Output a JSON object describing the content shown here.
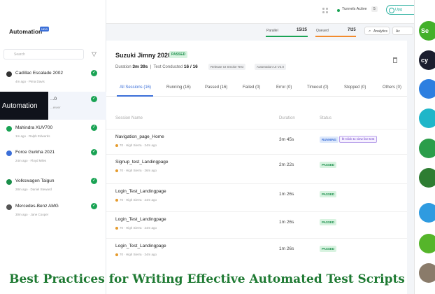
{
  "sidebar": {
    "title": "Automation",
    "badge": "NEW",
    "search_placeholder": "Search",
    "items": [
      {
        "name": "Cadillac Escalade 2002",
        "meta": "4m ago · Pima Davis",
        "color": "#333333"
      },
      {
        "name": "...0",
        "meta": "...eiwer",
        "color": "#3b6fd8"
      },
      {
        "name": "Mahindra XUV700",
        "meta": "1m ago · Ralph Edwards",
        "color": "#1aa354"
      },
      {
        "name": "Force Gurkha 2021",
        "meta": "24m ago · Floyd Miles",
        "color": "#3b6fd8"
      },
      {
        "name": "Volkswagen Taigun",
        "meta": "28m ago · Daniel Steward",
        "color": "#1a8e4a"
      },
      {
        "name": "Mercedes-Benz AMG",
        "meta": "30m ago · Jane Cooper",
        "color": "#555555"
      }
    ]
  },
  "overlay_label": "Automation",
  "topbar": {
    "tunnels_label": "Tunnels Active",
    "tunnels_count": "5",
    "upgrade_label": "Upg"
  },
  "stats": {
    "parallel_label": "Parallel",
    "parallel_value": "15/25",
    "queued_label": "Queued",
    "queued_value": "7/25",
    "analytics_label": "Analytics",
    "more_label": "Ac"
  },
  "build": {
    "title": "Suzuki Jimny 2020",
    "status": "PASSED",
    "duration_label": "Duration",
    "duration_value": "3m 39s",
    "tests_label": "Test Conducted",
    "tests_value": "16 / 16",
    "tags": [
      "Release UI Smoke Test",
      "Automation UI V2.0"
    ]
  },
  "tabs": [
    {
      "label": "All Sessions (16)",
      "active": true
    },
    {
      "label": "Running (16)",
      "active": false
    },
    {
      "label": "Passed (16)",
      "active": false
    },
    {
      "label": "Failed (0)",
      "active": false
    },
    {
      "label": "Error (0)",
      "active": false
    },
    {
      "label": "Timeout (0)",
      "active": false
    },
    {
      "label": "Stopped (0)",
      "active": false
    },
    {
      "label": "Others (0)",
      "active": false
    }
  ],
  "table": {
    "headers": [
      "Session Name",
      "Duration",
      "Status"
    ],
    "rows": [
      {
        "name": "Navigation_page_Home",
        "meta": "70 · High Sierra · 24m ago",
        "duration": "3m 45s",
        "status": "RUNNING",
        "live": "Click to view live test"
      },
      {
        "name": "Signup_test_Landingpage",
        "meta": "70 · High Sierra · 26m ago",
        "duration": "2m 22s",
        "status": "PASSED",
        "live": ""
      },
      {
        "name": "Login_Test_Landingpage",
        "meta": "70 · High Sierra · 24m ago",
        "duration": "1m 26s",
        "status": "PASSED",
        "live": ""
      },
      {
        "name": "Login_Test_Landingpage",
        "meta": "70 · High Sierra · 24m ago",
        "duration": "1m 26s",
        "status": "PASSED",
        "live": ""
      },
      {
        "name": "Login_Test_Landingpage",
        "meta": "70 · High Sierra · 24m ago",
        "duration": "1m 26s",
        "status": "PASSED",
        "live": ""
      }
    ]
  },
  "logos": [
    {
      "text": "Se",
      "color": "#43b02a"
    },
    {
      "text": "cy",
      "color": "#1b1e2e"
    },
    {
      "text": "",
      "color": "#2d7fe0"
    },
    {
      "text": "",
      "color": "#1fb6c9"
    },
    {
      "text": "",
      "color": "#2a9d4a"
    },
    {
      "text": "",
      "color": "#2e7d32"
    },
    {
      "text": "",
      "color": "#2f9be0"
    },
    {
      "text": "",
      "color": "#55b52a"
    },
    {
      "text": "",
      "color": "#8a7b6a"
    }
  ],
  "banner": "Best Practices for Writing Effective Automated Test Scripts"
}
